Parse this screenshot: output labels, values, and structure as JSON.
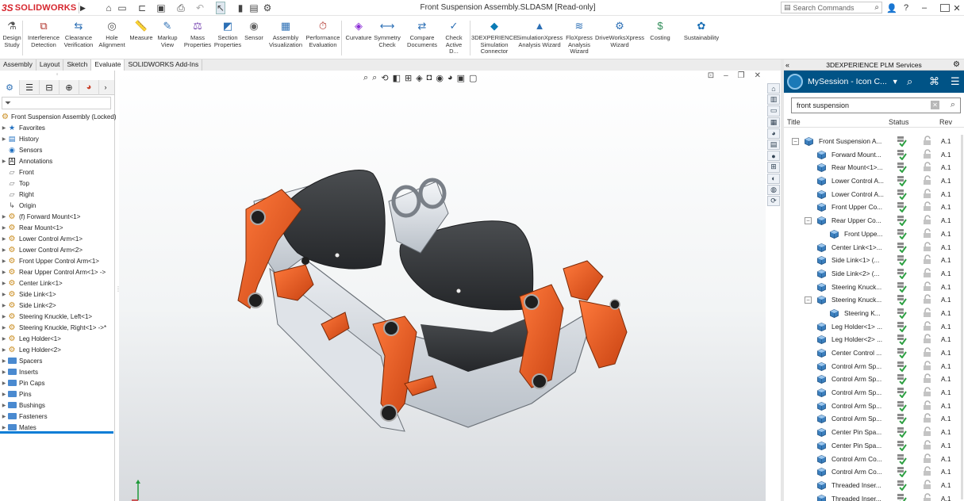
{
  "app": {
    "logo_prefix": "3S",
    "logo_name": "SOLIDWORKS",
    "window_title": "Front Suspension Assembly.SLDASM [Read-only]",
    "search_placeholder": "Search Commands",
    "help_label": "?"
  },
  "ribbon": {
    "buttons": [
      {
        "label": "Design\nStudy",
        "icon": "design-study-icon"
      },
      {
        "label": "Interference\nDetection",
        "icon": "interference-icon"
      },
      {
        "label": "Clearance\nVerification",
        "icon": "clearance-icon"
      },
      {
        "label": "Hole\nAlignment",
        "icon": "hole-alignment-icon"
      },
      {
        "label": "Measure",
        "icon": "measure-icon"
      },
      {
        "label": "Markup\nView",
        "icon": "markup-icon"
      },
      {
        "label": "Mass\nProperties",
        "icon": "mass-properties-icon"
      },
      {
        "label": "Section\nProperties",
        "icon": "section-properties-icon"
      },
      {
        "label": "Sensor",
        "icon": "sensor-icon"
      },
      {
        "label": "Assembly\nVisualization",
        "icon": "assembly-visualization-icon"
      },
      {
        "label": "Performance\nEvaluation",
        "icon": "performance-icon"
      },
      {
        "label": "Curvature",
        "icon": "curvature-icon"
      },
      {
        "label": "Symmetry\nCheck",
        "icon": "symmetry-icon"
      },
      {
        "label": "Compare\nDocuments",
        "icon": "compare-icon"
      },
      {
        "label": "Check\nActive D...",
        "icon": "check-active-icon"
      },
      {
        "label": "3DEXPERIENCE\nSimulation\nConnector",
        "icon": "simulation-connector-icon"
      },
      {
        "label": "SimulationXpress\nAnalysis Wizard",
        "icon": "simulationxpress-icon"
      },
      {
        "label": "FloXpress\nAnalysis\nWizard",
        "icon": "floxpress-icon"
      },
      {
        "label": "DriveWorksXpress\nWizard",
        "icon": "driveworks-icon"
      },
      {
        "label": "Costing",
        "icon": "costing-icon"
      },
      {
        "label": "Sustainability",
        "icon": "sustainability-icon"
      }
    ]
  },
  "cm_tabs": [
    "Assembly",
    "Layout",
    "Sketch",
    "Evaluate",
    "SOLIDWORKS Add-Ins"
  ],
  "cm_active_tab": "Evaluate",
  "feature_tree": {
    "root": "Front Suspension Assembly  (Locked)",
    "items": [
      {
        "label": "Favorites",
        "icon": "star-icon",
        "exp": true
      },
      {
        "label": "History",
        "icon": "history-icon",
        "exp": true
      },
      {
        "label": "Sensors",
        "icon": "sensor-icon",
        "exp": false
      },
      {
        "label": "Annotations",
        "icon": "annotation-icon",
        "exp": true
      },
      {
        "label": "Front",
        "icon": "plane-icon",
        "exp": false
      },
      {
        "label": "Top",
        "icon": "plane-icon",
        "exp": false
      },
      {
        "label": "Right",
        "icon": "plane-icon",
        "exp": false
      },
      {
        "label": "Origin",
        "icon": "origin-icon",
        "exp": false
      },
      {
        "label": "(f) Forward Mount<1>",
        "icon": "part-icon",
        "exp": true
      },
      {
        "label": "Rear Mount<1>",
        "icon": "part-icon",
        "exp": true
      },
      {
        "label": "Lower Control Arm<1>",
        "icon": "part-icon",
        "exp": true
      },
      {
        "label": "Lower Control Arm<2>",
        "icon": "part-icon",
        "exp": true
      },
      {
        "label": "Front Upper Control Arm<1>",
        "icon": "part-icon",
        "exp": true
      },
      {
        "label": "Rear Upper Control Arm<1> ->",
        "icon": "part-icon",
        "exp": true
      },
      {
        "label": "Center Link<1>",
        "icon": "part-icon",
        "exp": true
      },
      {
        "label": "Side Link<1>",
        "icon": "part-icon",
        "exp": true
      },
      {
        "label": "Side Link<2>",
        "icon": "part-icon",
        "exp": true
      },
      {
        "label": "Steering Knuckle, Left<1>",
        "icon": "part-icon",
        "exp": true
      },
      {
        "label": "Steering Knuckle, Right<1> ->*",
        "icon": "part-icon",
        "exp": true
      },
      {
        "label": "Leg Holder<1>",
        "icon": "part-icon",
        "exp": true
      },
      {
        "label": "Leg Holder<2>",
        "icon": "part-icon",
        "exp": true
      },
      {
        "label": "Spacers",
        "icon": "folder-icon",
        "exp": true
      },
      {
        "label": "Inserts",
        "icon": "folder-icon",
        "exp": true
      },
      {
        "label": "Pin Caps",
        "icon": "folder-icon",
        "exp": true
      },
      {
        "label": "Pins",
        "icon": "folder-icon",
        "exp": true
      },
      {
        "label": "Bushings",
        "icon": "folder-icon",
        "exp": true
      },
      {
        "label": "Fasteners",
        "icon": "folder-icon",
        "exp": true
      },
      {
        "label": "Mates",
        "icon": "folder-icon",
        "exp": true
      }
    ]
  },
  "dex": {
    "header": "3DEXPERIENCE PLM Services",
    "session": "MySession - Icon C...",
    "search_value": "front suspension",
    "columns": {
      "title": "Title",
      "status": "Status",
      "rev": "Rev"
    },
    "rows": [
      {
        "name": "Front Suspension A...",
        "level": 0,
        "toggle": "−",
        "rev": "A.1"
      },
      {
        "name": "Forward Mount...",
        "level": 1,
        "toggle": "",
        "rev": "A.1"
      },
      {
        "name": "Rear Mount<1>...",
        "level": 1,
        "toggle": "",
        "rev": "A.1"
      },
      {
        "name": "Lower Control A...",
        "level": 1,
        "toggle": "",
        "rev": "A.1"
      },
      {
        "name": "Lower Control A...",
        "level": 1,
        "toggle": "",
        "rev": "A.1"
      },
      {
        "name": "Front Upper Co...",
        "level": 1,
        "toggle": "",
        "rev": "A.1"
      },
      {
        "name": "Rear Upper Co...",
        "level": 1,
        "toggle": "−",
        "rev": "A.1"
      },
      {
        "name": "Front Uppe...",
        "level": 2,
        "toggle": "",
        "rev": "A.1"
      },
      {
        "name": "Center Link<1>...",
        "level": 1,
        "toggle": "",
        "rev": "A.1"
      },
      {
        "name": "Side Link<1> (...",
        "level": 1,
        "toggle": "",
        "rev": "A.1"
      },
      {
        "name": "Side Link<2> (...",
        "level": 1,
        "toggle": "",
        "rev": "A.1"
      },
      {
        "name": "Steering Knuck...",
        "level": 1,
        "toggle": "",
        "rev": "A.1"
      },
      {
        "name": "Steering Knuck...",
        "level": 1,
        "toggle": "−",
        "rev": "A.1"
      },
      {
        "name": "Steering K...",
        "level": 2,
        "toggle": "",
        "rev": "A.1"
      },
      {
        "name": "Leg Holder<1> ...",
        "level": 1,
        "toggle": "",
        "rev": "A.1"
      },
      {
        "name": "Leg Holder<2> ...",
        "level": 1,
        "toggle": "",
        "rev": "A.1"
      },
      {
        "name": "Center Control ...",
        "level": 1,
        "toggle": "",
        "rev": "A.1"
      },
      {
        "name": "Control Arm Sp...",
        "level": 1,
        "toggle": "",
        "rev": "A.1"
      },
      {
        "name": "Control Arm Sp...",
        "level": 1,
        "toggle": "",
        "rev": "A.1"
      },
      {
        "name": "Control Arm Sp...",
        "level": 1,
        "toggle": "",
        "rev": "A.1"
      },
      {
        "name": "Control Arm Sp...",
        "level": 1,
        "toggle": "",
        "rev": "A.1"
      },
      {
        "name": "Control Arm Sp...",
        "level": 1,
        "toggle": "",
        "rev": "A.1"
      },
      {
        "name": "Center Pin Spa...",
        "level": 1,
        "toggle": "",
        "rev": "A.1"
      },
      {
        "name": "Center Pin Spa...",
        "level": 1,
        "toggle": "",
        "rev": "A.1"
      },
      {
        "name": "Control Arm Co...",
        "level": 1,
        "toggle": "",
        "rev": "A.1"
      },
      {
        "name": "Control Arm Co...",
        "level": 1,
        "toggle": "",
        "rev": "A.1"
      },
      {
        "name": "Threaded Inser...",
        "level": 1,
        "toggle": "",
        "rev": "A.1"
      },
      {
        "name": "Threaded Inser...",
        "level": 1,
        "toggle": "",
        "rev": "A.1"
      }
    ]
  },
  "colors": {
    "accent_blue": "#005386",
    "brand_red": "#d6252d",
    "part_orange": "#e8551c",
    "status_green": "#2ea043"
  }
}
